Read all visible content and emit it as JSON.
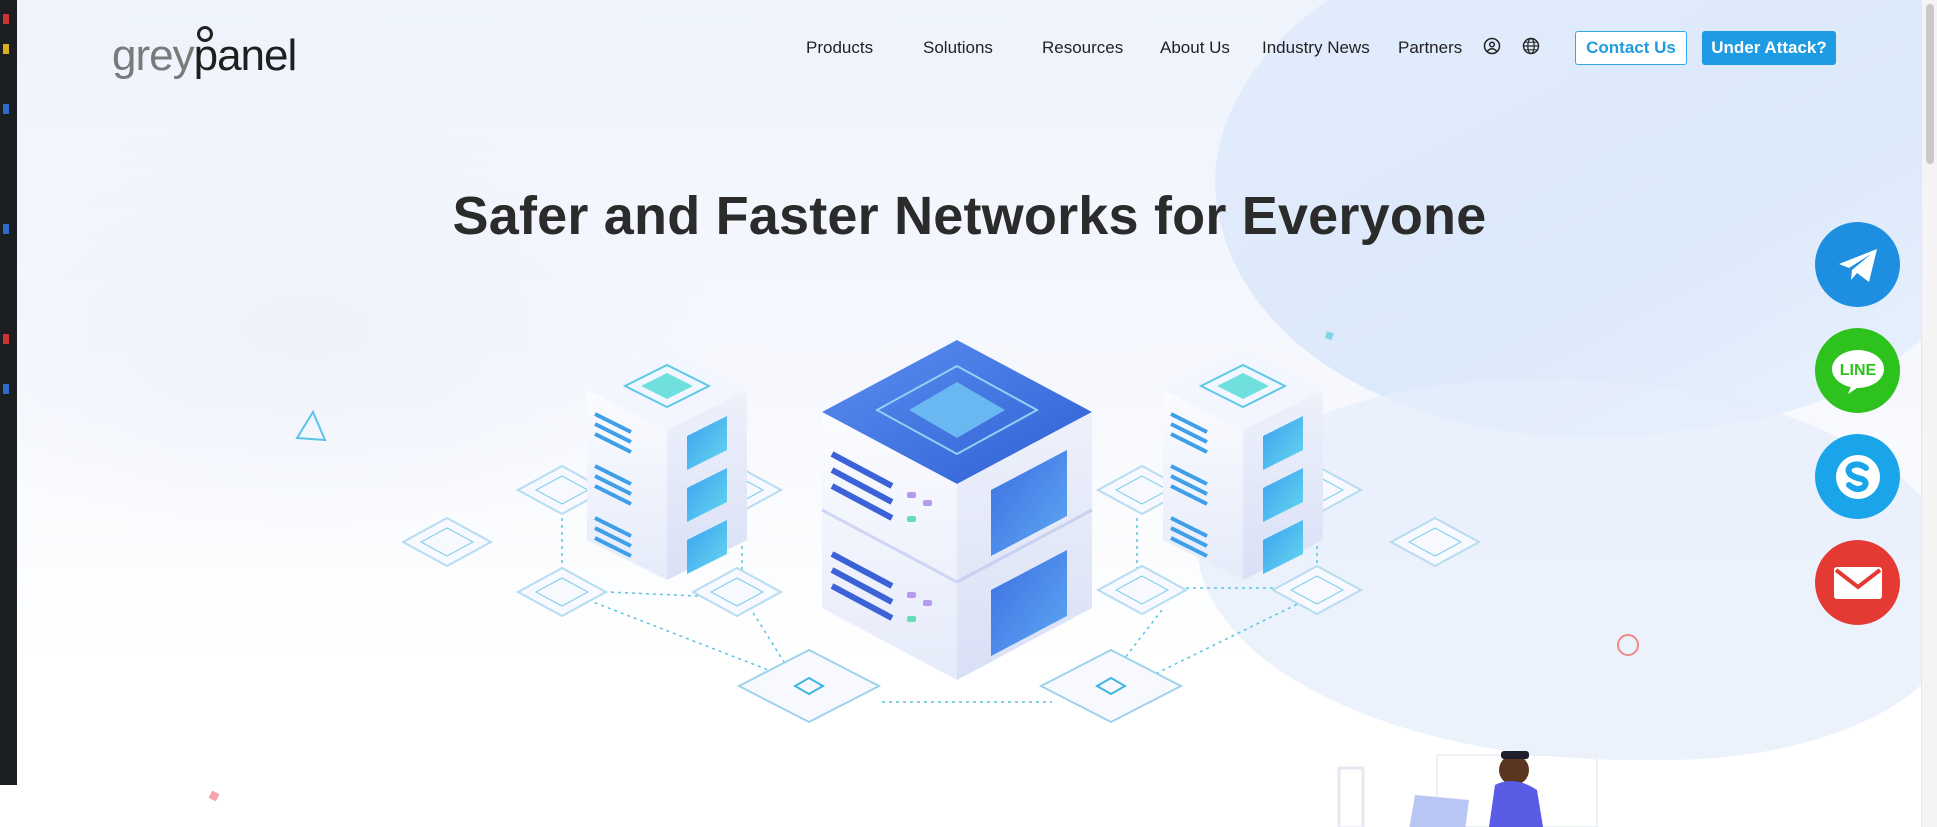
{
  "brand": {
    "logo_grey": "grey",
    "logo_panel": "panel"
  },
  "nav": {
    "items": [
      {
        "label": "Products"
      },
      {
        "label": "Solutions"
      },
      {
        "label": "Resources"
      },
      {
        "label": "About Us"
      },
      {
        "label": "Industry News"
      },
      {
        "label": "Partners"
      }
    ]
  },
  "header": {
    "account_icon": "user-circle-icon",
    "language_icon": "globe-icon",
    "contact_label": "Contact Us",
    "attack_label": "Under Attack?"
  },
  "hero": {
    "title": "Safer and Faster Networks for Everyone"
  },
  "social": {
    "telegram": {
      "icon": "telegram-icon",
      "color": "#1e8fe0"
    },
    "line": {
      "icon": "line-icon",
      "label": "LINE",
      "color": "#2ec21e"
    },
    "skype": {
      "icon": "skype-icon",
      "color": "#1aa5ea"
    },
    "email": {
      "icon": "email-icon",
      "color": "#e53a34"
    }
  },
  "colors": {
    "accent": "#1e9be3",
    "server_top": "#3f73e0",
    "node_cyan": "#5fd6e5"
  }
}
